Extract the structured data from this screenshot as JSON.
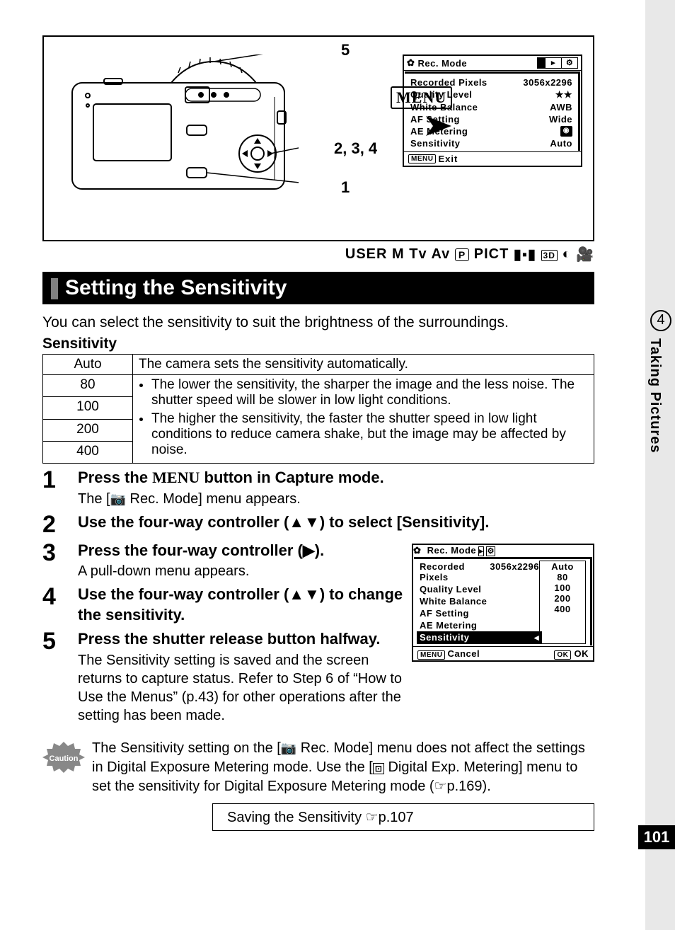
{
  "diagram": {
    "callout5": "5",
    "callout234": "2, 3, 4",
    "callout1": "1",
    "menu_label": "MENU"
  },
  "lcd1": {
    "title": "Rec. Mode",
    "rows": [
      {
        "label": "Recorded Pixels",
        "value": "3056x2296"
      },
      {
        "label": "Quality Level",
        "value": "★★"
      },
      {
        "label": "White Balance",
        "value": "AWB"
      },
      {
        "label": "AF Setting",
        "value": "Wide"
      },
      {
        "label": "AE Metering",
        "value": "◉"
      },
      {
        "label": "Sensitivity",
        "value": "Auto"
      }
    ],
    "footer_btn": "MENU",
    "footer_label": "Exit"
  },
  "mode_row": {
    "user": "USER",
    "m": "M",
    "tv": "Tv",
    "av": "Av",
    "p": "P",
    "pict": "PICT",
    "td": "3D"
  },
  "h1": "Setting the Sensitivity",
  "intro": "You can select the sensitivity to suit the brightness of the surroundings.",
  "sub_h": "Sensitivity",
  "table": {
    "auto_label": "Auto",
    "auto_desc": "The camera sets the sensitivity automatically.",
    "v80": "80",
    "v100": "100",
    "v200": "200",
    "v400": "400",
    "bullet1": "The lower the sensitivity, the sharper the image and the less noise. The shutter speed will be slower in low light conditions.",
    "bullet2": "The higher the sensitivity, the faster the shutter speed in low light conditions to reduce camera shake, but the image may be affected by noise."
  },
  "steps": {
    "s1_pre": "Press the ",
    "s1_menu": "MENU",
    "s1_post": " button in Capture mode.",
    "s1_desc_pre": "The [",
    "s1_desc_post": " Rec. Mode] menu appears.",
    "s2": "Use the four-way controller (▲▼) to select [Sensitivity].",
    "s3_title": "Press the four-way controller (▶).",
    "s3_desc": "A pull-down menu appears.",
    "s4": "Use the four-way controller (▲▼) to change the sensitivity.",
    "s5_title": "Press the shutter release button halfway.",
    "s5_desc": "The Sensitivity setting is saved and the screen returns to capture status. Refer to Step 6 of “How to Use the Menus” (p.43) for other operations after the setting has been made."
  },
  "lcd2": {
    "title": "Rec. Mode",
    "row_rp_l": "Recorded Pixels",
    "row_rp_v": "3056x2296",
    "row_ql": "Quality Level",
    "row_wb": "White Balance",
    "row_af": "AF Setting",
    "row_ae": "AE Metering",
    "row_sens": "Sensitivity",
    "opts": [
      "Auto",
      "80",
      "100",
      "200",
      "400"
    ],
    "cancel_btn": "MENU",
    "cancel_label": "Cancel",
    "ok_btn": "OK",
    "ok_label": "OK"
  },
  "caution": {
    "label": "Caution",
    "text_pre": "The Sensitivity setting on the [",
    "text_mid1": " Rec. Mode] menu does not affect the settings in Digital Exposure Metering mode. Use the [",
    "text_mid2": " Digital Exp. Metering] menu to set the sensitivity for Digital Exposure Metering mode (",
    "text_post": "p.169)."
  },
  "ref_box_pre": "Saving the Sensitivity ",
  "ref_box_post": "p.107",
  "side": {
    "chapter": "4",
    "label": "Taking Pictures"
  },
  "page_number": "101"
}
